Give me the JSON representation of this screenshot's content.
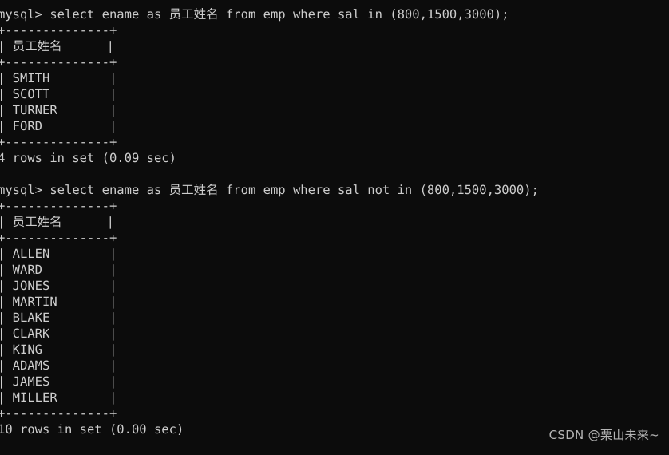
{
  "terminal": {
    "background_color": "#0c0c0c",
    "text_color": "#cdcdcd",
    "prompt": "mysql>",
    "lines": [
      "mysql> select ename as 员工姓名 from emp where sal in (800,1500,3000);",
      "+--------------+",
      "| 员工姓名      |",
      "+--------------+",
      "| SMITH        |",
      "| SCOTT        |",
      "| TURNER       |",
      "| FORD         |",
      "+--------------+",
      "4 rows in set (0.09 sec)",
      "",
      "mysql> select ename as 员工姓名 from emp where sal not in (800,1500,3000);",
      "+--------------+",
      "| 员工姓名      |",
      "+--------------+",
      "| ALLEN        |",
      "| WARD         |",
      "| JONES        |",
      "| MARTIN       |",
      "| BLAKE        |",
      "| CLARK        |",
      "| KING         |",
      "| ADAMS        |",
      "| JAMES        |",
      "| MILLER       |",
      "+--------------+",
      "10 rows in set (0.00 sec)"
    ]
  },
  "queries": [
    {
      "sql": "select ename as 员工姓名 from emp where sal in (800,1500,3000);",
      "column_header": "员工姓名",
      "rows": [
        "SMITH",
        "SCOTT",
        "TURNER",
        "FORD"
      ],
      "status": "4 rows in set (0.09 sec)",
      "row_count": 4,
      "elapsed_sec": "0.09"
    },
    {
      "sql": "select ename as 员工姓名 from emp where sal not in (800,1500,3000);",
      "column_header": "员工姓名",
      "rows": [
        "ALLEN",
        "WARD",
        "JONES",
        "MARTIN",
        "BLAKE",
        "CLARK",
        "KING",
        "ADAMS",
        "JAMES",
        "MILLER"
      ],
      "status": "10 rows in set (0.00 sec)",
      "row_count": 10,
      "elapsed_sec": "0.00"
    }
  ],
  "watermark": {
    "text": "CSDN @栗山未来~"
  }
}
